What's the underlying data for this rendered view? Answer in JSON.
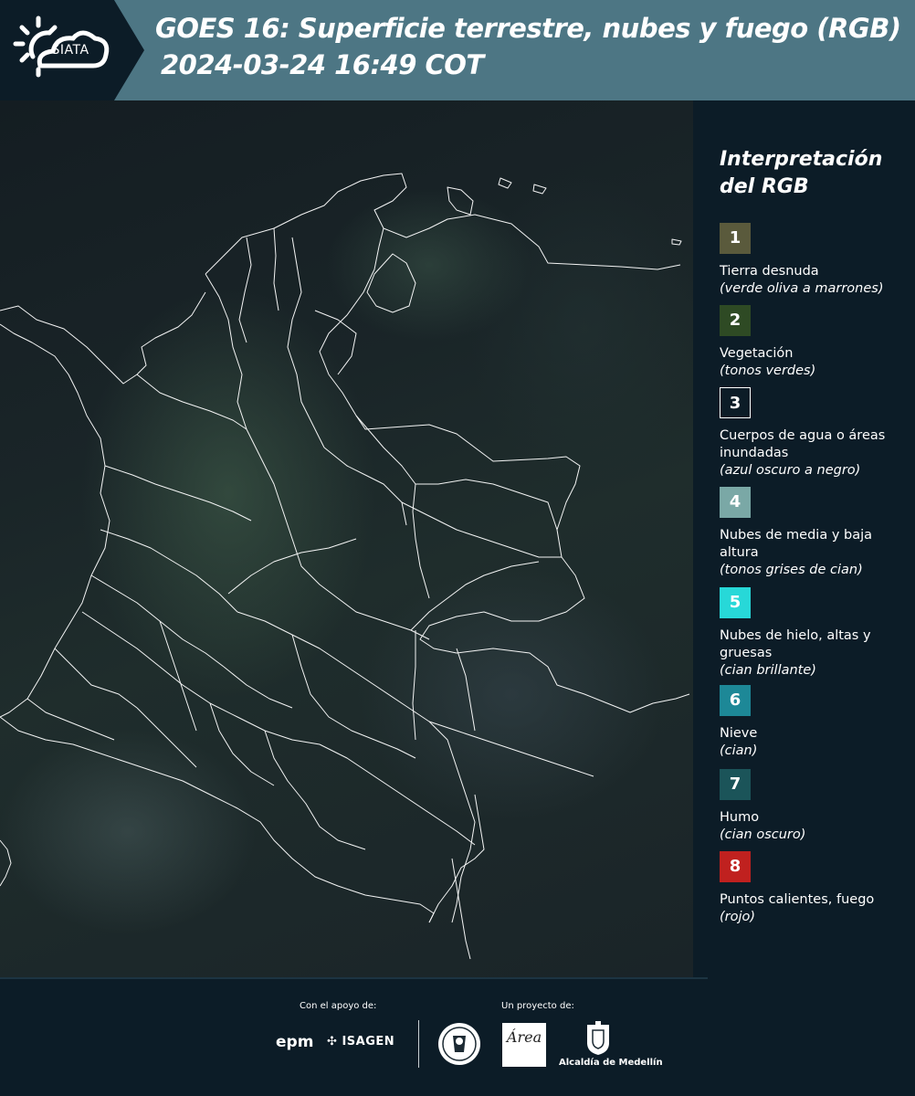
{
  "header": {
    "logo_text": "SIATA",
    "title_line1": "GOES 16: Superficie terrestre, nubes y fuego (RGB)",
    "title_line2": "2024-03-24 16:49 COT",
    "background_color": "#4d7684"
  },
  "legend": {
    "title": "Interpretación del RGB",
    "items": [
      {
        "number": "1",
        "label": "Tierra desnuda",
        "description": "(verde oliva a marrones)",
        "color": "#5a5a3c"
      },
      {
        "number": "2",
        "label": "Vegetación",
        "description": "(tonos verdes)",
        "color": "#2e4a24"
      },
      {
        "number": "3",
        "label": "Cuerpos de agua o áreas inundadas",
        "description": "(azul oscuro a negro)",
        "color": "#0c1c27"
      },
      {
        "number": "4",
        "label": "Nubes de media y baja altura",
        "description": "(tonos grises de cian)",
        "color": "#7aa8a6"
      },
      {
        "number": "5",
        "label": "Nubes de hielo, altas y gruesas",
        "description": "(cian brillante)",
        "color": "#27d8d8"
      },
      {
        "number": "6",
        "label": "Nieve",
        "description": "(cian)",
        "color": "#1d8897"
      },
      {
        "number": "7",
        "label": "Humo",
        "description": "(cian oscuro)",
        "color": "#1b5459"
      },
      {
        "number": "8",
        "label": "Puntos calientes, fuego",
        "description": "(rojo)",
        "color": "#c0211f"
      }
    ]
  },
  "footer": {
    "support_caption": "Con el apoyo de:",
    "project_caption": "Un proyecto de:",
    "sponsors": [
      "epm",
      "ISAGEN"
    ],
    "area_logo_text": "Área",
    "alcaldia_text": "Alcaldía de Medellín"
  }
}
